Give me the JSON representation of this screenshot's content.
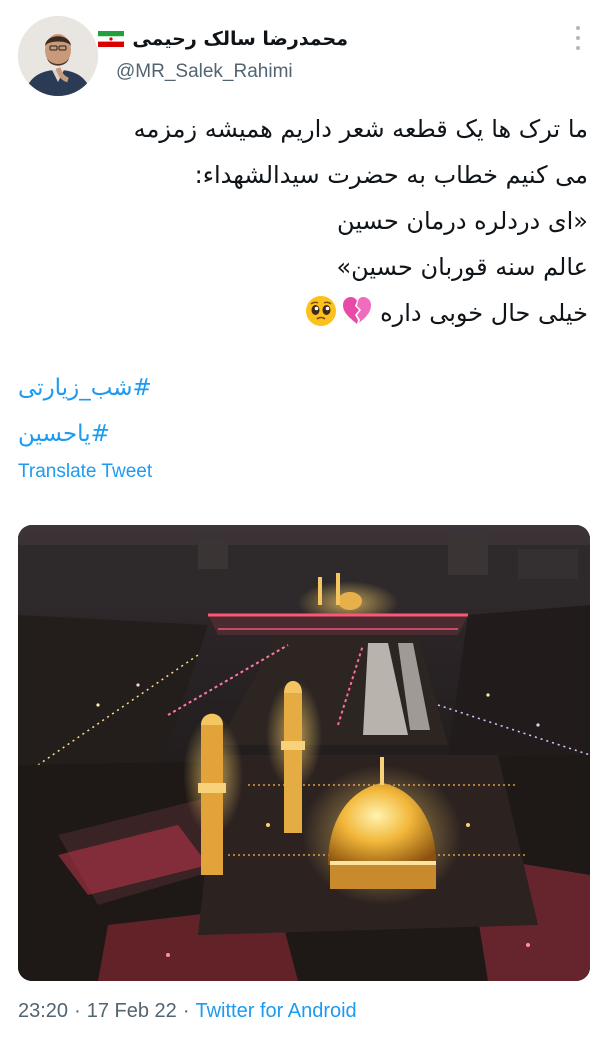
{
  "user": {
    "display_name": "محمدرضا سالک رحیمی",
    "handle": "@MR_Salek_Rahimi",
    "flag_icon": "iran-flag-icon"
  },
  "tweet": {
    "lines": [
      "ما ترک ها یک قطعه شعر داریم همیشه زمزمه",
      "می کنیم خطاب به حضرت سیدالشهداء:",
      "«ای دردلره درمان حسین",
      "عالم سنه قوربان حسین»",
      "خیلی حال خوبی داره"
    ],
    "emojis": [
      "broken-heart-emoji",
      "pleading-face-emoji"
    ],
    "hashtags": [
      "#شب_زیارتی",
      "#یاحسین"
    ],
    "translate_label": "Translate Tweet"
  },
  "media": {
    "image_name": "shrine-aerial-photo"
  },
  "footer": {
    "time": "23:20",
    "separator1": "·",
    "date": "17 Feb 22",
    "separator2": "·",
    "source": "Twitter for Android"
  },
  "colors": {
    "link": "#1d9bf0",
    "secondary": "#536471",
    "text": "#0f1419"
  }
}
